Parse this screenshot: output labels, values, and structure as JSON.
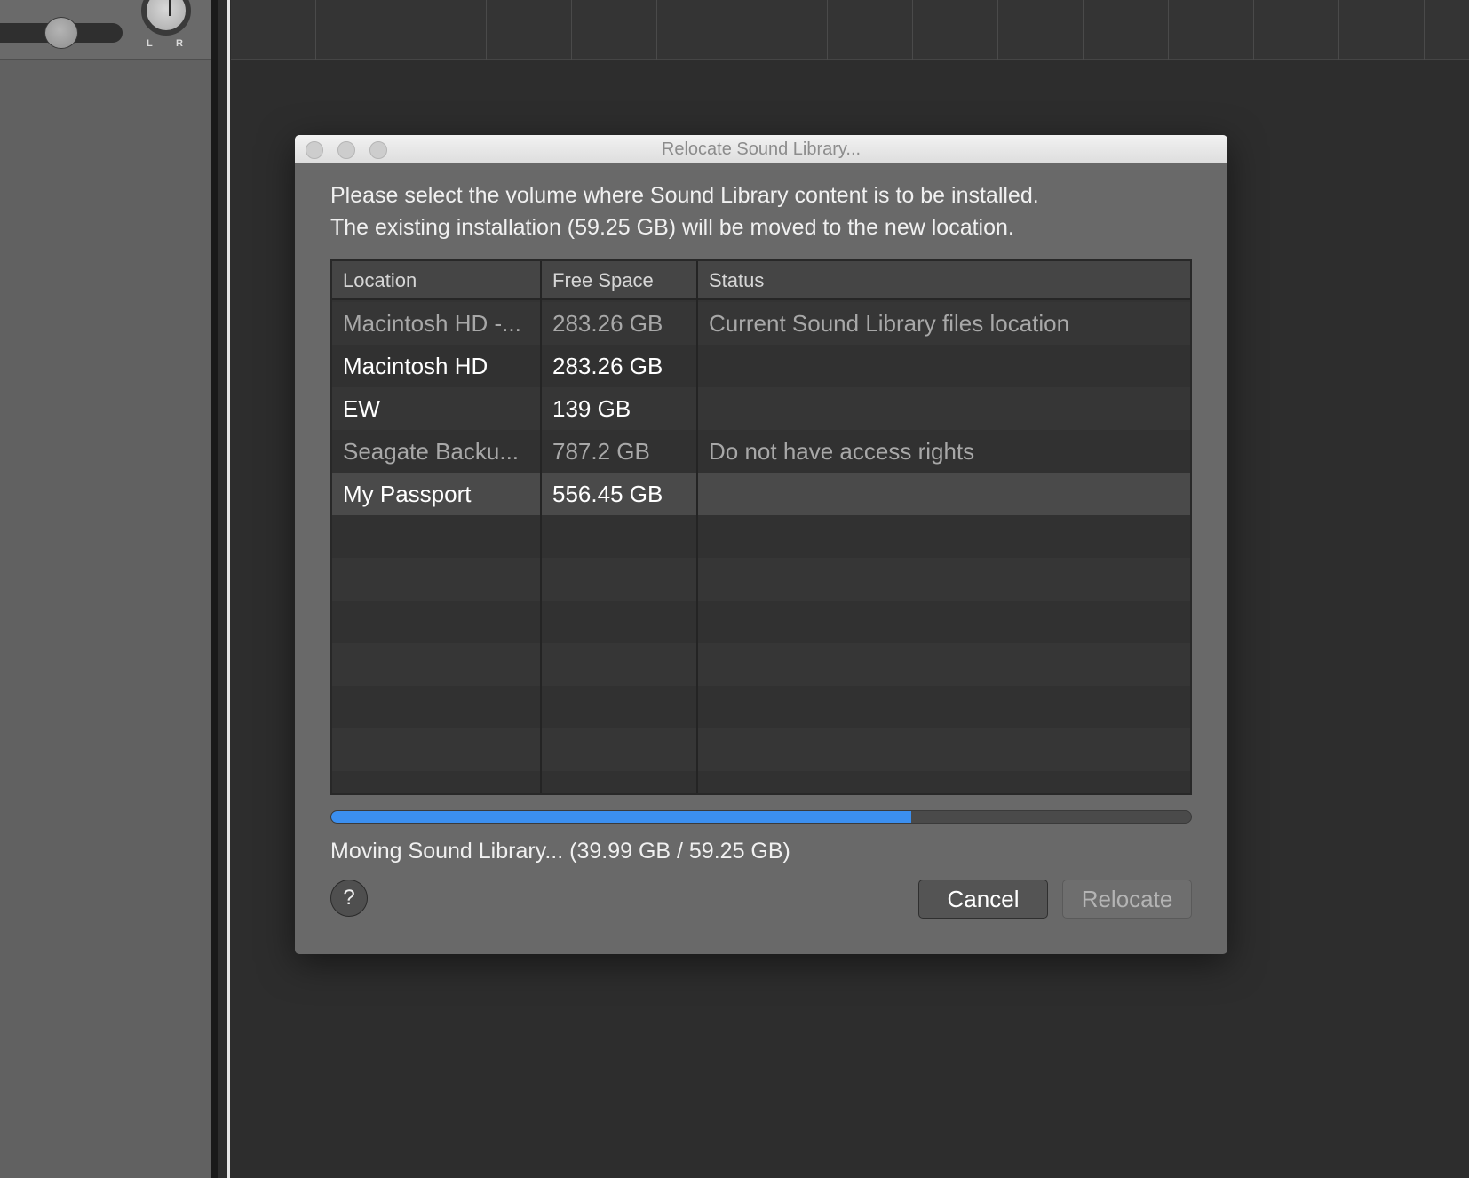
{
  "mixer": {
    "pan_left_label": "L",
    "pan_right_label": "R"
  },
  "dialog": {
    "title": "Relocate Sound Library...",
    "message_line1": "Please select the volume where Sound Library content is to be installed.",
    "message_line2": "The existing installation (59.25 GB) will be moved to the new location.",
    "table": {
      "columns": [
        "Location",
        "Free Space",
        "Status"
      ],
      "rows": [
        {
          "location": "Macintosh HD -...",
          "free_space": "283.26 GB",
          "status": "Current Sound Library files location",
          "enabled": false,
          "selected": false
        },
        {
          "location": "Macintosh HD",
          "free_space": "283.26 GB",
          "status": "",
          "enabled": true,
          "selected": false
        },
        {
          "location": "EW",
          "free_space": "139 GB",
          "status": "",
          "enabled": true,
          "selected": false
        },
        {
          "location": "Seagate Backu...",
          "free_space": "787.2 GB",
          "status": "Do not have access rights",
          "enabled": false,
          "selected": false
        },
        {
          "location": "My Passport",
          "free_space": "556.45 GB",
          "status": "",
          "enabled": true,
          "selected": true
        }
      ]
    },
    "progress": {
      "fraction": 0.675,
      "text": "Moving Sound Library... (39.99 GB / 59.25 GB)"
    },
    "help_label": "?",
    "cancel_label": "Cancel",
    "relocate_label": "Relocate"
  },
  "colors": {
    "accent": "#3b8ff0",
    "dialog_bg": "#696969",
    "row_enabled_text": "#ffffff",
    "row_disabled_text": "#a8a8a8",
    "row_selected_bg": "#4a4a4a"
  }
}
